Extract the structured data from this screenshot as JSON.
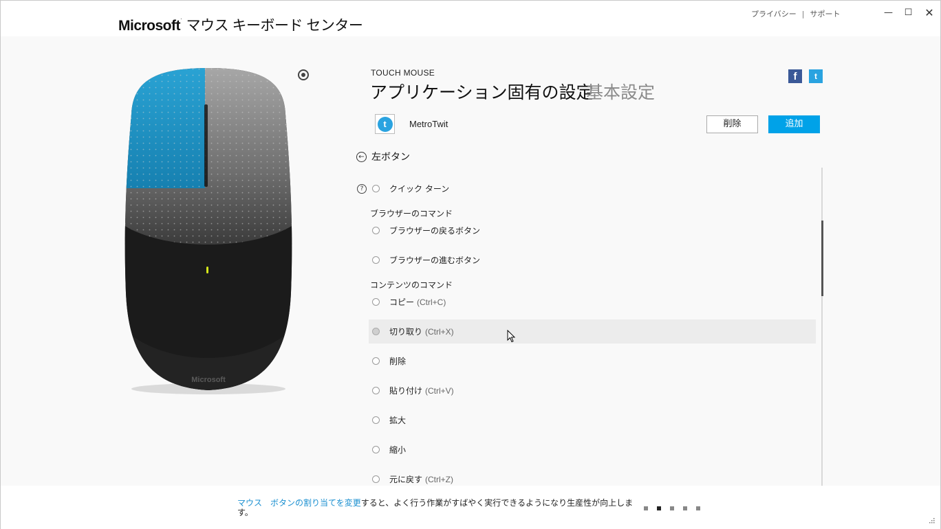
{
  "titlebar": {
    "brand": "Microsoft",
    "app_title": "マウス キーボード センター",
    "links": [
      "プライバシー",
      "サポート"
    ],
    "separator": "|",
    "minimize": "—",
    "maximize": "☐",
    "close": "✕"
  },
  "device": {
    "name": "TOUCH MOUSE",
    "logo_text": "Microsoft",
    "highlight_color": "#1a8fc0"
  },
  "tabs": {
    "active": "アプリケーション固有の設定",
    "inactive": "基本設定"
  },
  "social": {
    "facebook": "f",
    "twitter": "t"
  },
  "app": {
    "icon": "t",
    "name": "MetroTwit",
    "delete_label": "削除",
    "add_label": "追加"
  },
  "back": {
    "label": "左ボタン"
  },
  "list": {
    "help": "?",
    "options": [
      {
        "label": "クイック ターン",
        "shortcut": ""
      },
      {
        "label": "ブラウザーの戻るボタン",
        "shortcut": ""
      },
      {
        "label": "ブラウザーの進むボタン",
        "shortcut": ""
      },
      {
        "label": "コピー",
        "shortcut": "(Ctrl+C)"
      },
      {
        "label": "切り取り",
        "shortcut": "(Ctrl+X)"
      },
      {
        "label": "削除",
        "shortcut": ""
      },
      {
        "label": "貼り付け",
        "shortcut": "(Ctrl+V)"
      },
      {
        "label": "拡大",
        "shortcut": ""
      },
      {
        "label": "縮小",
        "shortcut": ""
      },
      {
        "label": "元に戻す",
        "shortcut": "(Ctrl+Z)"
      }
    ],
    "sections": [
      "ブラウザーのコマンド",
      "コンテンツのコマンド"
    ]
  },
  "tip": {
    "link1": "マウス",
    "link2": "ボタンの割り当てを変更",
    "text": "すると、よく行う作業がすばやく実行できるようになり生産性が向上します。"
  },
  "colors": {
    "accent": "#00a2e8",
    "link": "#1a8fd0"
  }
}
